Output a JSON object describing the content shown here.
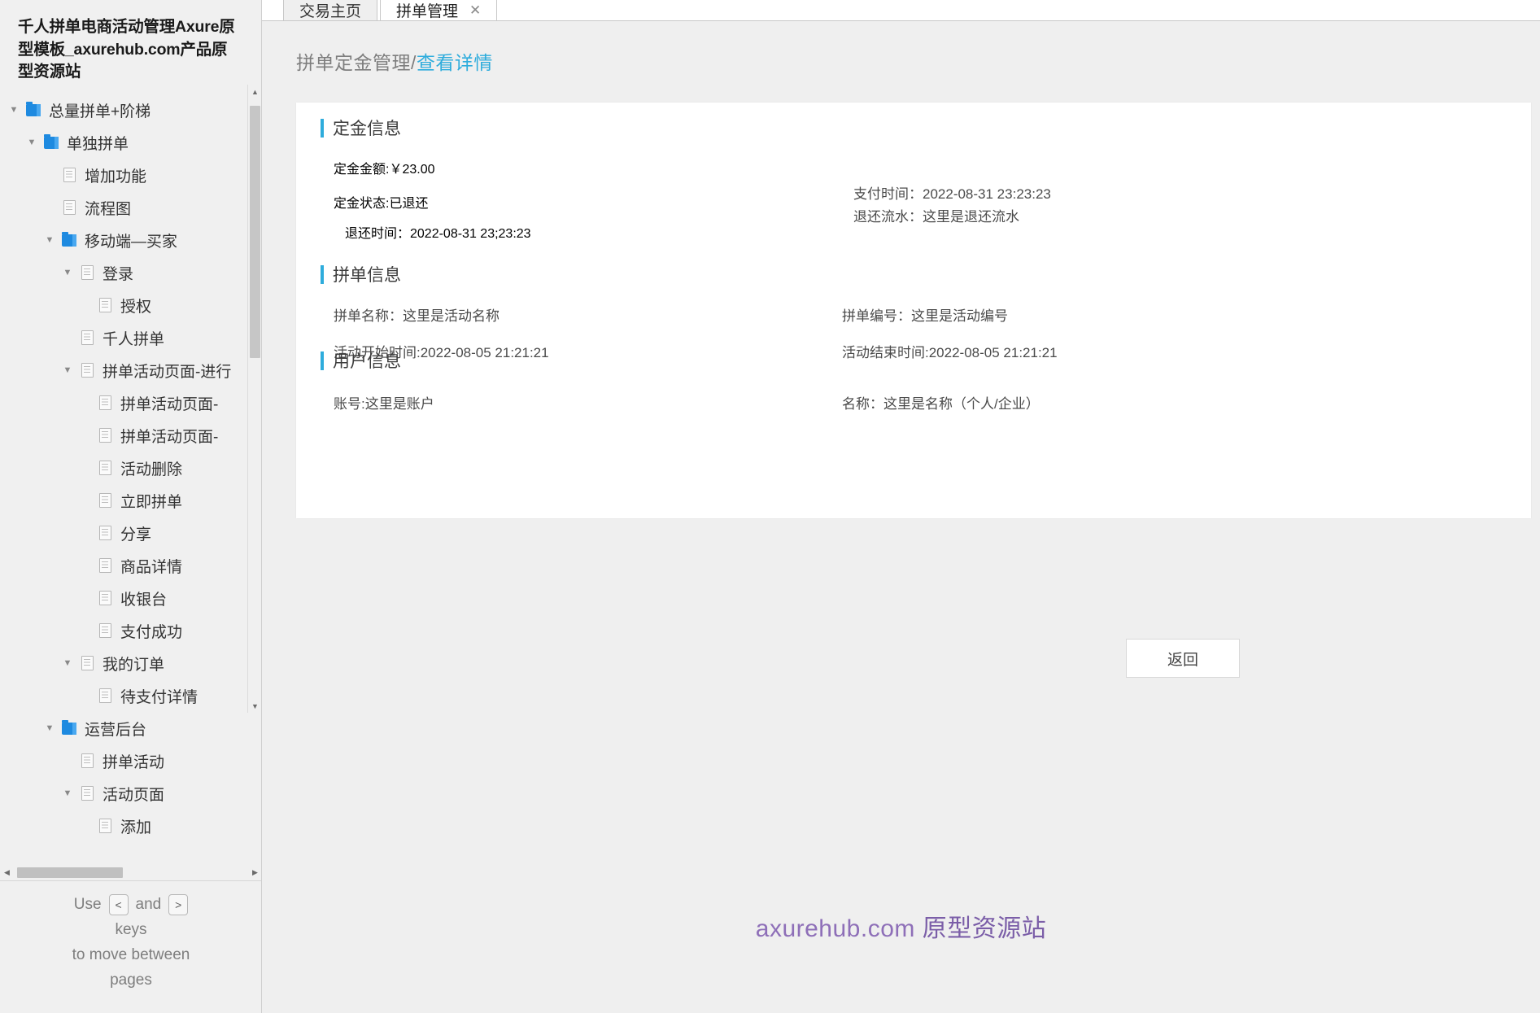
{
  "sidebar": {
    "title": "千人拼单电商活动管理Axure原型模板_axurehub.com产品原型资源站",
    "tree": [
      {
        "depth": 0,
        "twisty": "▼",
        "icon": "folder-icon",
        "label": "总量拼单+阶梯"
      },
      {
        "depth": 1,
        "twisty": "▼",
        "icon": "folder-icon",
        "label": "单独拼单"
      },
      {
        "depth": 2,
        "twisty": "",
        "icon": "page-icon",
        "label": "增加功能"
      },
      {
        "depth": 2,
        "twisty": "",
        "icon": "page-icon",
        "label": "流程图"
      },
      {
        "depth": 2,
        "twisty": "▼",
        "icon": "folder-icon",
        "label": "移动端—买家"
      },
      {
        "depth": 3,
        "twisty": "▼",
        "icon": "page-icon",
        "label": "登录"
      },
      {
        "depth": 4,
        "twisty": "",
        "icon": "page-icon",
        "label": "授权"
      },
      {
        "depth": 3,
        "twisty": "",
        "icon": "page-icon",
        "label": "千人拼单"
      },
      {
        "depth": 3,
        "twisty": "▼",
        "icon": "page-icon",
        "label": "拼单活动页面-进行"
      },
      {
        "depth": 4,
        "twisty": "",
        "icon": "page-icon",
        "label": "拼单活动页面-"
      },
      {
        "depth": 4,
        "twisty": "",
        "icon": "page-icon",
        "label": "拼单活动页面-"
      },
      {
        "depth": 4,
        "twisty": "",
        "icon": "page-icon",
        "label": "活动删除"
      },
      {
        "depth": 4,
        "twisty": "",
        "icon": "page-icon",
        "label": "立即拼单"
      },
      {
        "depth": 4,
        "twisty": "",
        "icon": "page-icon",
        "label": "分享"
      },
      {
        "depth": 4,
        "twisty": "",
        "icon": "page-icon",
        "label": "商品详情"
      },
      {
        "depth": 4,
        "twisty": "",
        "icon": "page-icon",
        "label": "收银台"
      },
      {
        "depth": 4,
        "twisty": "",
        "icon": "page-icon",
        "label": "支付成功"
      },
      {
        "depth": 3,
        "twisty": "▼",
        "icon": "page-icon",
        "label": "我的订单"
      },
      {
        "depth": 4,
        "twisty": "",
        "icon": "page-icon",
        "label": "待支付详情"
      },
      {
        "depth": 2,
        "twisty": "▼",
        "icon": "folder-icon",
        "label": "运营后台"
      },
      {
        "depth": 3,
        "twisty": "",
        "icon": "page-icon",
        "label": "拼单活动"
      },
      {
        "depth": 3,
        "twisty": "▼",
        "icon": "page-icon",
        "label": "活动页面"
      },
      {
        "depth": 4,
        "twisty": "",
        "icon": "page-icon",
        "label": "添加"
      }
    ],
    "key_hint": {
      "use": "Use",
      "prev_key": "<",
      "and": "and",
      "next_key": ">",
      "keys_word": "keys",
      "line2": "to move between",
      "line3": "pages"
    }
  },
  "tabs": [
    {
      "label": "交易主页",
      "active": false,
      "closable": false
    },
    {
      "label": "拼单管理",
      "active": true,
      "closable": true,
      "close_glyph": "✕"
    }
  ],
  "breadcrumb": {
    "parent": "拼单定金管理/",
    "current": "查看详情"
  },
  "deposit": {
    "section_title": "定金信息",
    "amount": "定金金额:￥23.00",
    "status": "定金状态:已退还",
    "refund_time": "退还时间：2022-08-31 23;23:23",
    "pay_time": "支付时间：2022-08-31 23:23:23",
    "refund_serial": "退还流水：这里是退还流水"
  },
  "group_order": {
    "section_title": "拼单信息",
    "name": "拼单名称：这里是活动名称",
    "code": "拼单编号：这里是活动编号",
    "start_time": "活动开始时间:2022-08-05 21:21:21",
    "end_time": "活动结束时间:2022-08-05 21:21:21"
  },
  "user_info": {
    "section_title": "用户信息",
    "account": "账号:这里是账户",
    "name": "名称：这里是名称（个人/企业）"
  },
  "actions": {
    "back_label": "返回"
  },
  "watermark": {
    "site": "axurehub.com ",
    "cn": "原型资源站"
  },
  "colors": {
    "accent": "#2eacdc",
    "folder": "#1e8ae0",
    "watermark": "#8e6fb8"
  }
}
